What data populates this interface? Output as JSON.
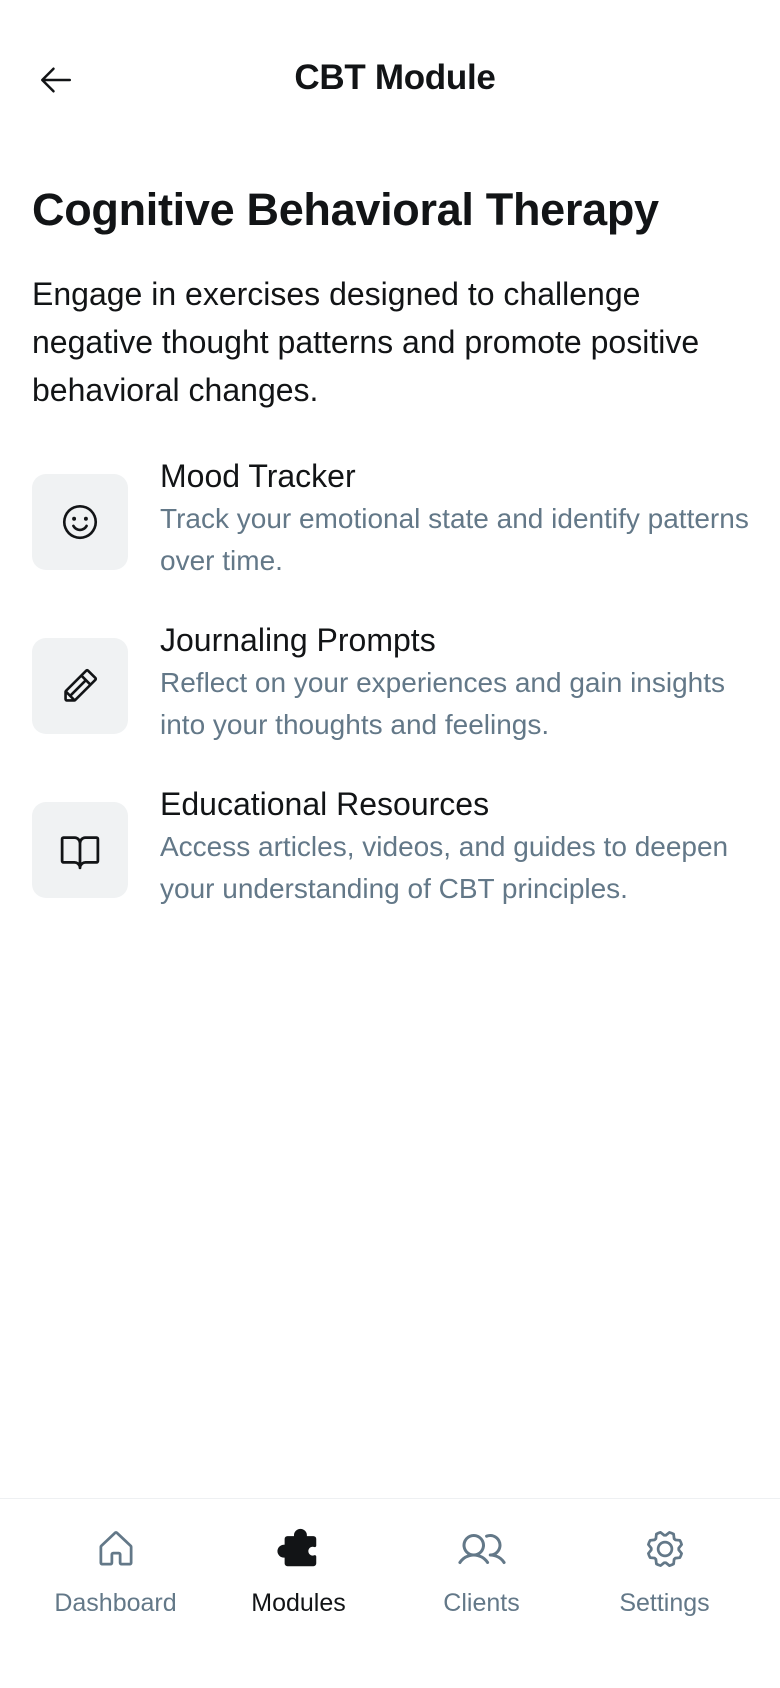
{
  "header": {
    "title": "CBT Module",
    "back_icon": "arrow-left-icon"
  },
  "main": {
    "title": "Cognitive Behavioral Therapy",
    "intro": "Engage in exercises designed to challenge negative thought patterns and promote positive behavioral changes."
  },
  "modules": [
    {
      "icon": "smiley-icon",
      "title": "Mood Tracker",
      "description": "Track your emotional state and identify patterns over time."
    },
    {
      "icon": "pencil-icon",
      "title": "Journaling Prompts",
      "description": "Reflect on your experiences and gain insights into your thoughts and feelings."
    },
    {
      "icon": "book-open-icon",
      "title": "Educational Resources",
      "description": "Access articles, videos, and guides to deepen your understanding of CBT principles."
    }
  ],
  "bottom_nav": {
    "active": "Modules",
    "items": [
      {
        "label": "Dashboard",
        "icon": "house-icon"
      },
      {
        "label": "Modules",
        "icon": "puzzle-piece-icon"
      },
      {
        "label": "Clients",
        "icon": "users-icon"
      },
      {
        "label": "Settings",
        "icon": "gear-icon"
      }
    ]
  },
  "colors": {
    "primary_text": "#121416",
    "secondary_text": "#637888",
    "icon_tile_bg": "#f0f2f3"
  }
}
